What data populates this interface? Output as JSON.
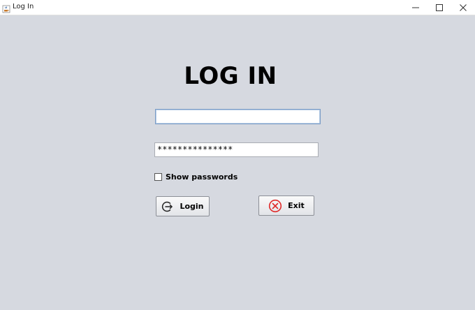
{
  "window": {
    "title": "Log In",
    "app_icon": "java-cup-icon",
    "controls": [
      "minimize-icon",
      "maximize-icon",
      "close-icon"
    ]
  },
  "form": {
    "heading": "LOG IN",
    "username": {
      "value": "",
      "placeholder": ""
    },
    "password": {
      "masked_value": "***************"
    },
    "show_passwords": {
      "label": "Show passwords",
      "checked": false
    },
    "login_button": {
      "label": "Login",
      "icon": "logout-arrow-icon"
    },
    "exit_button": {
      "label": "Exit",
      "icon": "cancel-circle-icon"
    }
  },
  "colors": {
    "background": "#d6d9e0",
    "exit_icon": "#e02a2a",
    "focus_border": "#7a9cc6"
  }
}
